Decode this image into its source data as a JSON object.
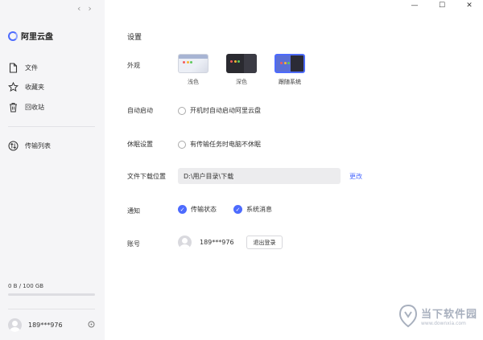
{
  "window": {
    "nav_back": "‹",
    "nav_forward": "›",
    "minimize": "—",
    "maximize": "☐",
    "close": "✕"
  },
  "app": {
    "name": "阿里云盘"
  },
  "sidebar": {
    "items": [
      {
        "label": "文件",
        "icon": "file-icon"
      },
      {
        "label": "收藏夹",
        "icon": "star-icon"
      },
      {
        "label": "回收站",
        "icon": "trash-icon"
      },
      {
        "label": "传输列表",
        "icon": "transfer-icon"
      }
    ],
    "storage": {
      "text": "0 B / 100 GB",
      "used_fraction": 0
    },
    "user": {
      "name": "189***976"
    }
  },
  "settings": {
    "title": "设置",
    "appearance": {
      "label": "外观",
      "themes": [
        {
          "label": "浅色",
          "selected": false
        },
        {
          "label": "深色",
          "selected": false
        },
        {
          "label": "跟随系统",
          "selected": true
        }
      ]
    },
    "autostart": {
      "label": "自动启动",
      "option": "开机时自动启动阿里云盘",
      "checked": false
    },
    "sleep": {
      "label": "休眠设置",
      "option": "有传输任务时电脑不休眠",
      "checked": false
    },
    "download": {
      "label": "文件下载位置",
      "path": "D:\\用户目录\\下载",
      "change": "更改"
    },
    "notify": {
      "label": "通知",
      "options": [
        {
          "label": "传输状态",
          "checked": true
        },
        {
          "label": "系统消息",
          "checked": true
        }
      ]
    },
    "account": {
      "label": "账号",
      "name": "189***976",
      "logout": "退出登录"
    }
  },
  "watermark": {
    "title": "当下软件园",
    "url": "www.downxia.com"
  },
  "colors": {
    "accent": "#4d6bfe",
    "sidebar_bg": "#f5f5f7"
  }
}
